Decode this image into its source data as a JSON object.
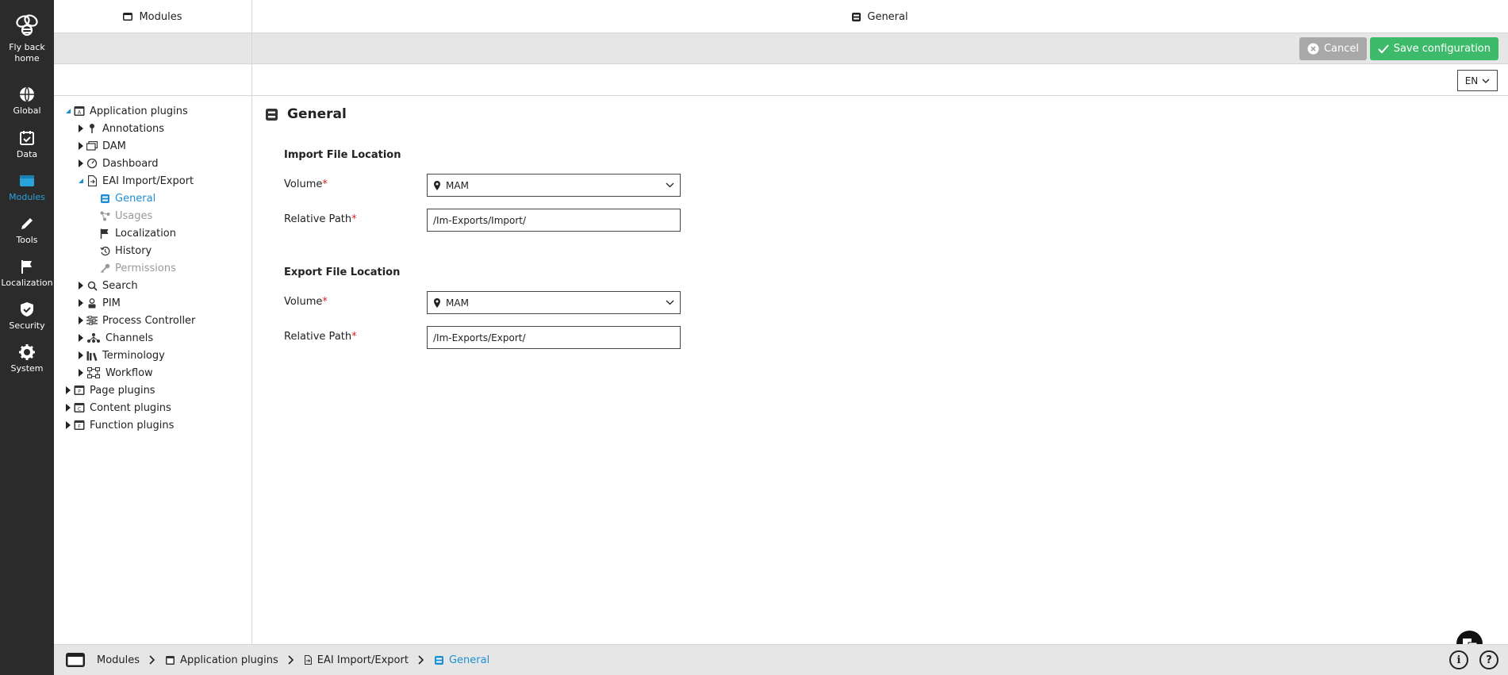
{
  "nav": {
    "home_label": "Fly back home",
    "items": [
      {
        "label": "Global",
        "icon": "globe-icon"
      },
      {
        "label": "Data",
        "icon": "calendar-check-icon"
      },
      {
        "label": "Modules",
        "icon": "window-icon"
      },
      {
        "label": "Tools",
        "icon": "pencil-icon"
      },
      {
        "label": "Localization",
        "icon": "flag-icon"
      },
      {
        "label": "Security",
        "icon": "shield-check-icon"
      },
      {
        "label": "System",
        "icon": "gear-icon"
      }
    ],
    "active": "Modules",
    "accent_color": "#29a3dc"
  },
  "header": {
    "left_title": "Modules",
    "right_title": "General"
  },
  "toolbar": {
    "cancel_label": "Cancel",
    "save_label": "Save configuration",
    "save_color": "#3dbb6b"
  },
  "lang": {
    "selected": "EN"
  },
  "tree": {
    "items": [
      {
        "label": "Application plugins"
      },
      {
        "label": "Annotations"
      },
      {
        "label": "DAM"
      },
      {
        "label": "Dashboard"
      },
      {
        "label": "EAI Import/Export"
      },
      {
        "label": "General"
      },
      {
        "label": "Usages"
      },
      {
        "label": "Localization"
      },
      {
        "label": "History"
      },
      {
        "label": "Permissions"
      },
      {
        "label": "Search"
      },
      {
        "label": "PIM"
      },
      {
        "label": "Process Controller"
      },
      {
        "label": "Channels"
      },
      {
        "label": "Terminology"
      },
      {
        "label": "Workflow"
      },
      {
        "label": "Page plugins"
      },
      {
        "label": "Content plugins"
      },
      {
        "label": "Function plugins"
      }
    ]
  },
  "content": {
    "title": "General",
    "import": {
      "title": "Import File Location",
      "volume_label": "Volume",
      "volume_value": "MAM",
      "path_label": "Relative Path",
      "path_value": "/Im-Exports/Import/"
    },
    "export": {
      "title": "Export File Location",
      "volume_label": "Volume",
      "volume_value": "MAM",
      "path_label": "Relative Path",
      "path_value": "/Im-Exports/Export/"
    },
    "required_mark": "*"
  },
  "breadcrumb": {
    "items": [
      "Modules",
      "Application plugins",
      "EAI Import/Export",
      "General"
    ]
  },
  "footer": {
    "info_symbol": "i",
    "help_symbol": "?"
  }
}
